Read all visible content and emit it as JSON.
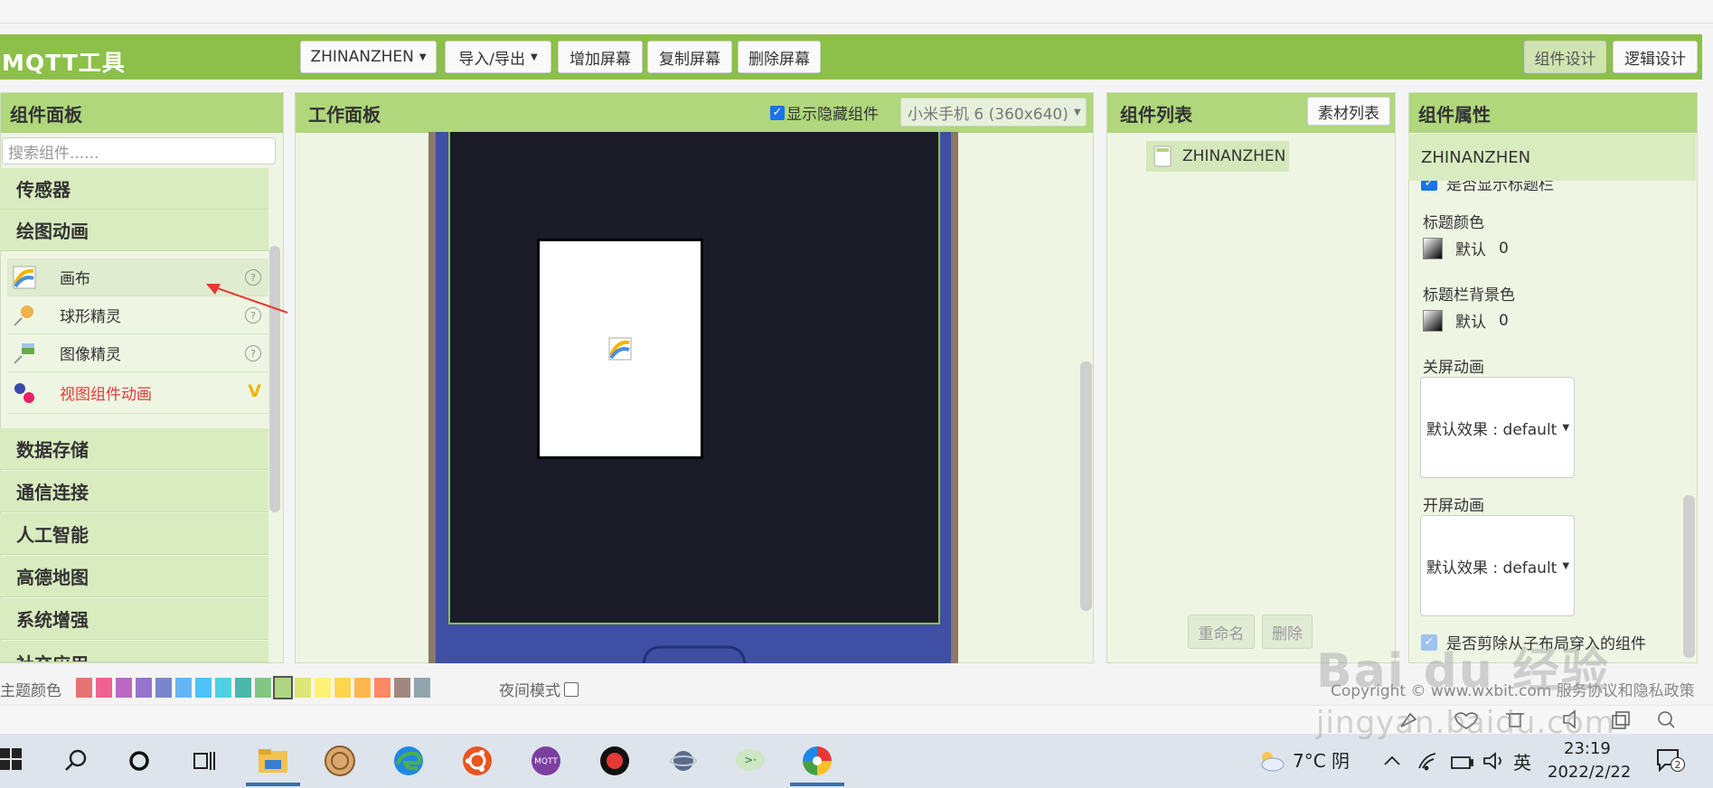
{
  "app": {
    "title": "MQTT工具",
    "project_select": "ZHINANZHEN",
    "toolbar": {
      "import_export": "导入/导出",
      "add_screen": "增加屏幕",
      "copy_screen": "复制屏幕",
      "delete_screen": "删除屏幕",
      "component_design": "组件设计",
      "logic_design": "逻辑设计"
    }
  },
  "palette": {
    "title": "组件面板",
    "search_placeholder": "搜索组件......",
    "categories_top": [
      "传感器",
      "绘图动画"
    ],
    "items": [
      {
        "label": "画布",
        "badge": "?"
      },
      {
        "label": "球形精灵",
        "badge": "?"
      },
      {
        "label": "图像精灵",
        "badge": "?"
      },
      {
        "label": "视图组件动画",
        "badge": "V"
      }
    ],
    "categories_bottom": [
      "数据存储",
      "通信连接",
      "人工智能",
      "高德地图",
      "系统增强",
      "社交应用"
    ]
  },
  "workspace": {
    "title": "工作面板",
    "show_hidden_label": "显示隐藏组件",
    "show_hidden_checked": true,
    "device": "小米手机 6 (360x640)"
  },
  "component_list": {
    "title": "组件列表",
    "assets_button": "素材列表",
    "root": "ZHINANZHEN",
    "rename_button": "重命名",
    "delete_button": "删除"
  },
  "properties": {
    "title": "组件属性",
    "component_name": "ZHINANZHEN",
    "show_titlebar_label": "是否显示标题栏",
    "title_color_label": "标题颜色",
    "title_color_value": "默认",
    "title_color_num": "0",
    "titlebar_bg_label": "标题栏背景色",
    "titlebar_bg_value": "默认",
    "titlebar_bg_num": "0",
    "close_anim_label": "关屏动画",
    "close_anim_value": "默认效果 : default",
    "open_anim_label": "开屏动画",
    "open_anim_value": "默认效果 : default",
    "crop_children_label": "是否剪除从子布局穿入的组件"
  },
  "theme": {
    "label": "主题颜色",
    "colors": [
      "#e57373",
      "#f06292",
      "#ba68c8",
      "#9575cd",
      "#7986cb",
      "#64b5f6",
      "#4fc3f7",
      "#4dd0e1",
      "#4db6ac",
      "#81c784",
      "#aed581",
      "#dce775",
      "#fff176",
      "#ffd54f",
      "#ffb74d",
      "#ff8a65",
      "#a1887f",
      "#90a4ae"
    ],
    "night_mode_label": "夜间模式",
    "copyright": "Copyright © www.wxbit.com 服务协议和隐私政策"
  },
  "taskbar": {
    "weather": "7°C 阴",
    "ime": "英",
    "time": "23:19",
    "date": "2022/2/22",
    "notifications": "2"
  },
  "watermark": {
    "line1": "Bai du 经验",
    "line2": "jingyan.baidu.com"
  }
}
